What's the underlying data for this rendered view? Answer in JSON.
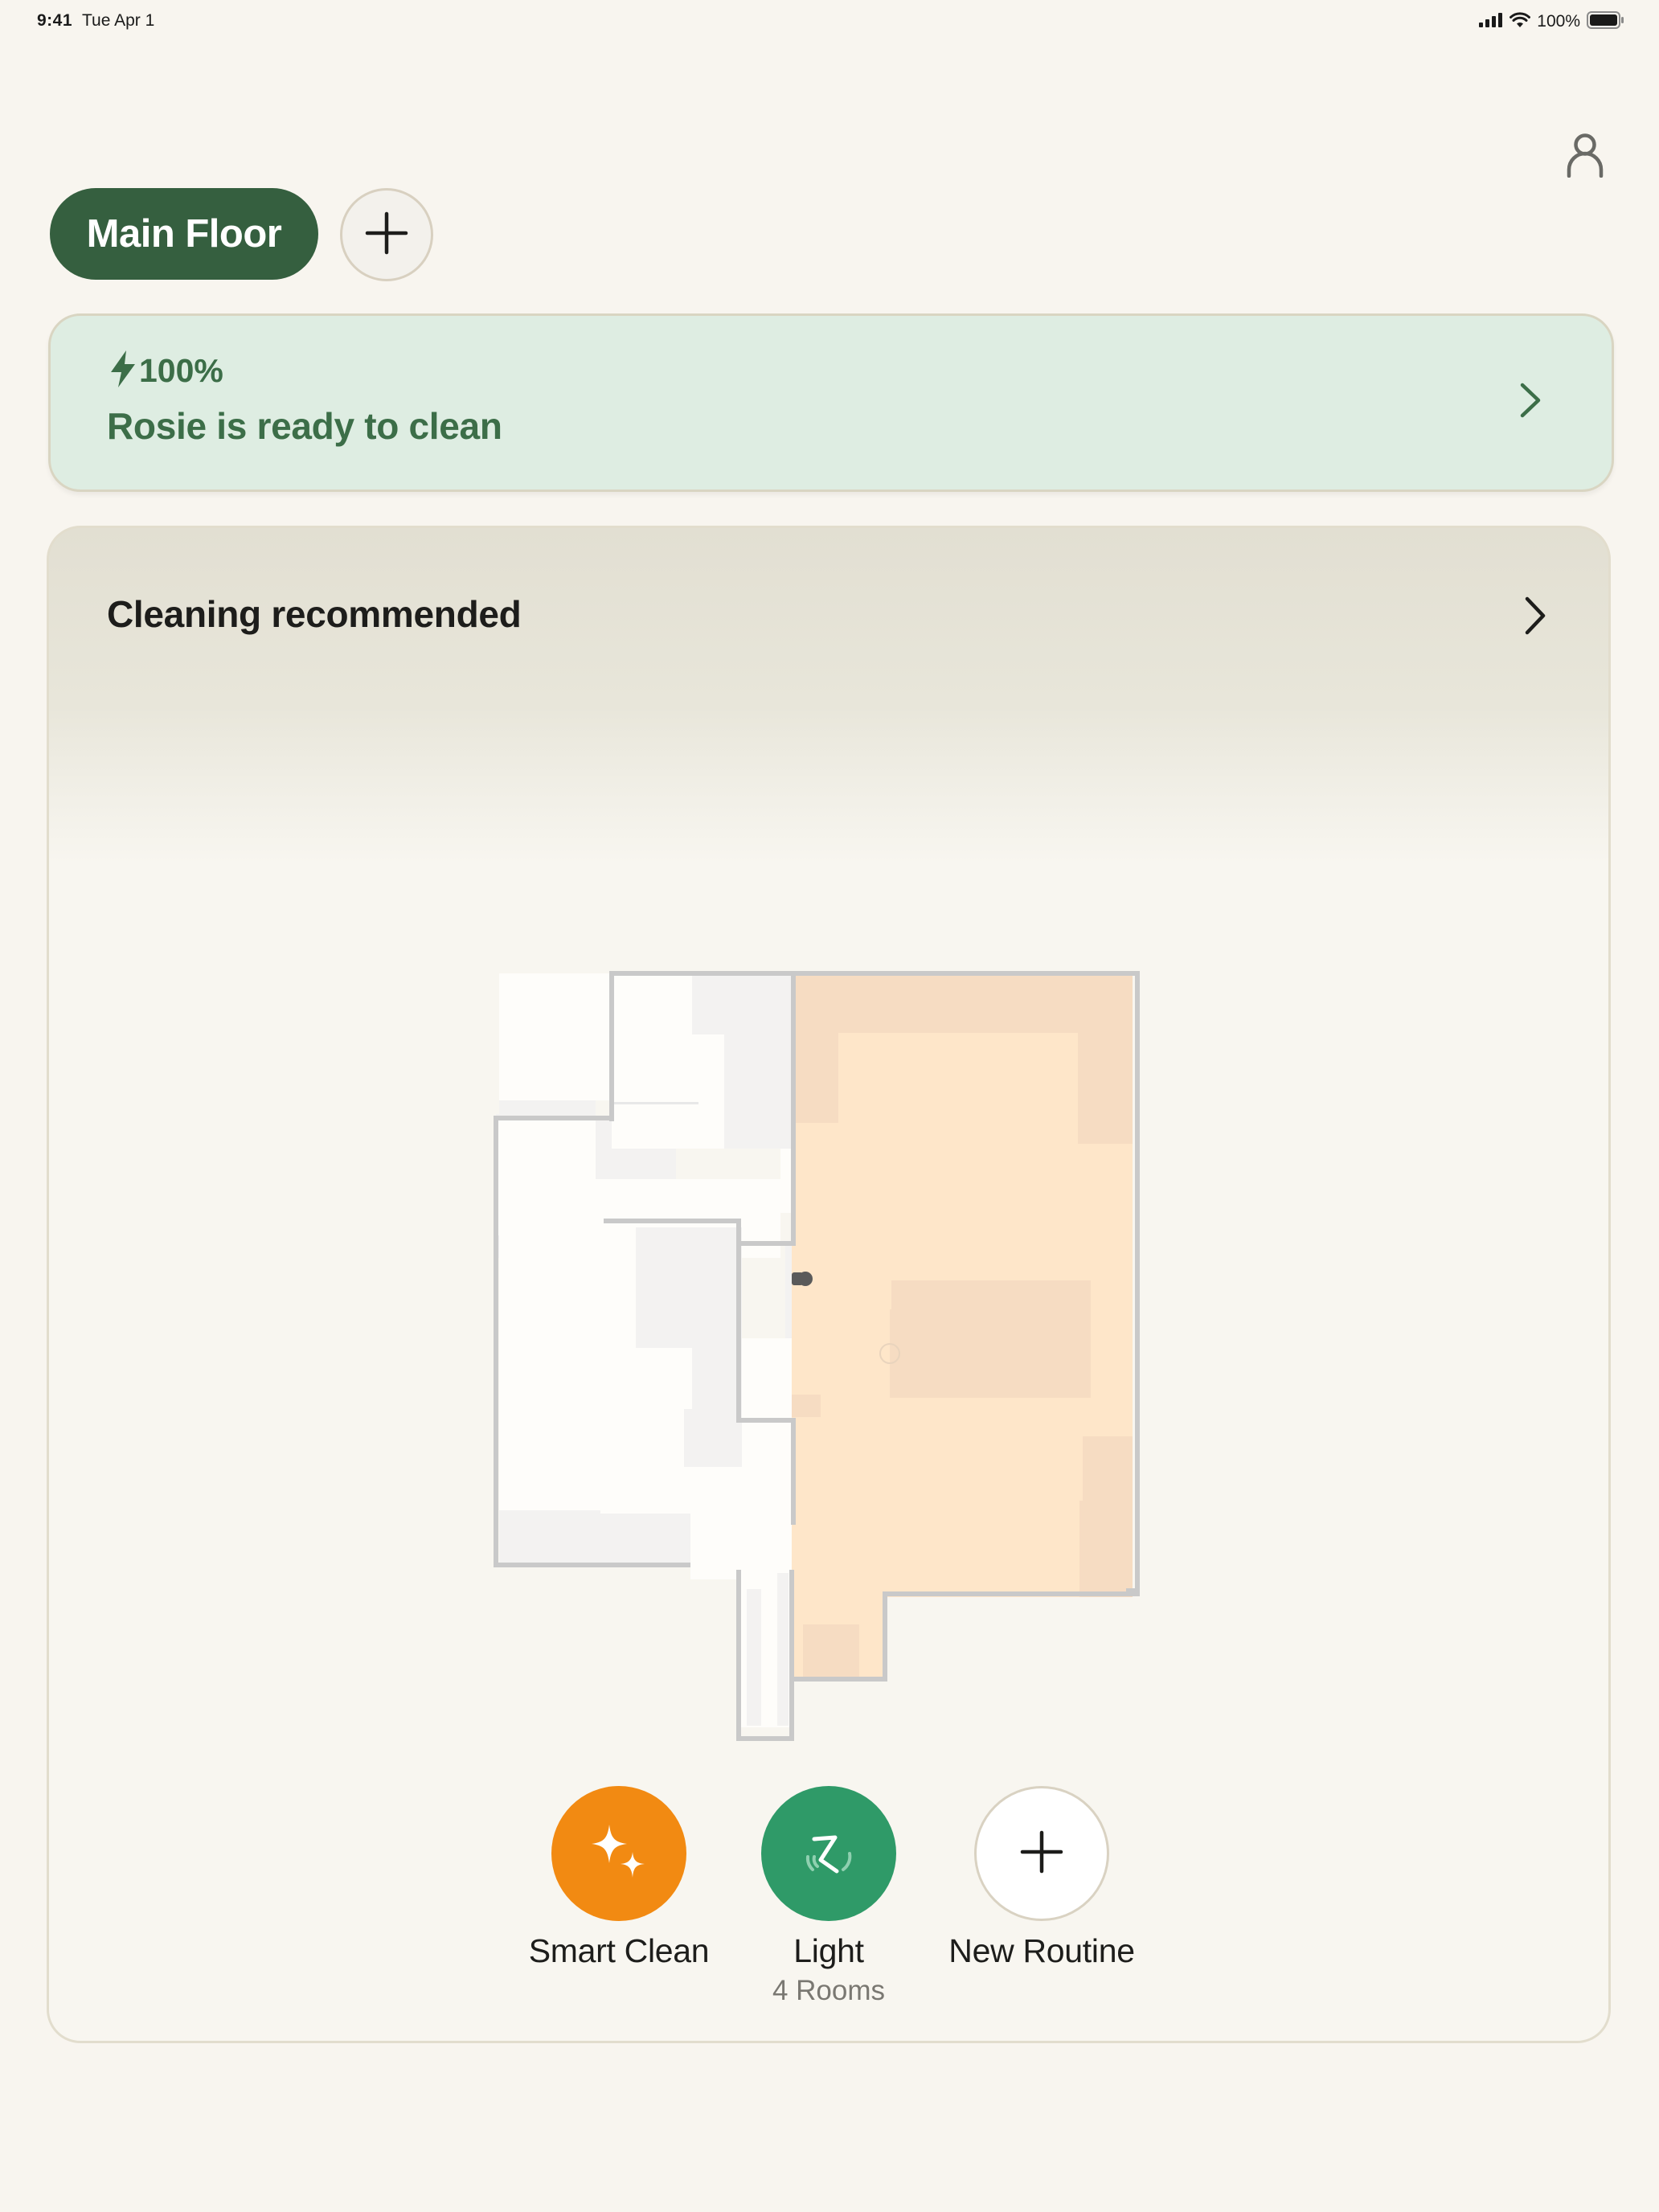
{
  "status_bar": {
    "time": "9:41",
    "date": "Tue Apr 1",
    "battery": "100%",
    "icons": [
      "cellular-signal-icon",
      "wifi-icon",
      "battery-icon"
    ]
  },
  "header": {
    "profile_icon": "person-icon"
  },
  "floors": {
    "active": "Main Floor",
    "add_icon": "plus-icon"
  },
  "robot_status": {
    "battery": "100%",
    "battery_icon": "lightning-bolt-icon",
    "message": "Rosie is ready to clean",
    "chevron_icon": "chevron-right-icon",
    "accent": "#3c6e48"
  },
  "recommendation": {
    "title": "Cleaning recommended",
    "chevron_icon": "chevron-right-icon"
  },
  "routines": [
    {
      "label": "Smart Clean",
      "sublabel": "",
      "icon": "sparkles-icon",
      "color": "#f28a12"
    },
    {
      "label": "Light",
      "sublabel": "4 Rooms",
      "icon": "light-clean-icon",
      "color": "#2f9a68"
    },
    {
      "label": "New Routine",
      "sublabel": "",
      "icon": "plus-icon",
      "color": "#ffffff"
    }
  ],
  "colors": {
    "background": "#f8f5ef",
    "floor_tab": "#355f3f",
    "status_card": "#deede2",
    "recommended_room": "#fee6c9"
  }
}
